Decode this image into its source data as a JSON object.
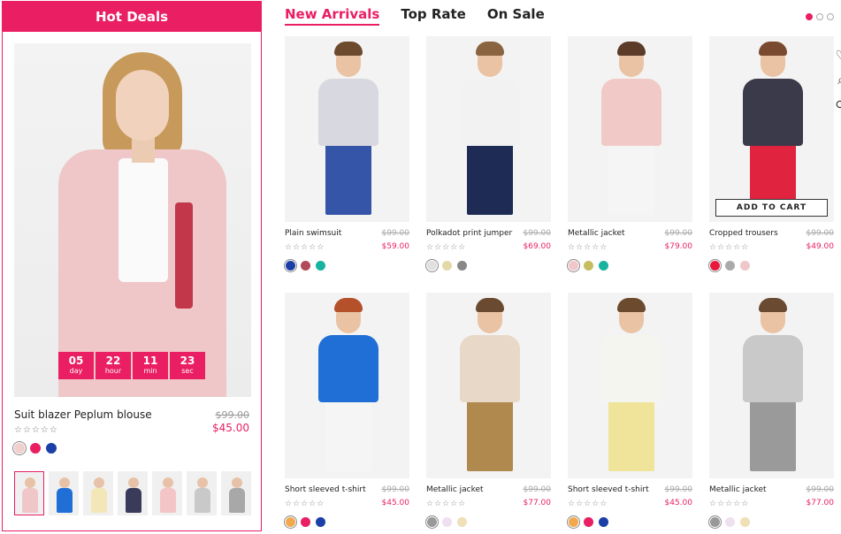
{
  "hot_deals": {
    "title": "Hot Deals",
    "product": {
      "name": "Suit blazer Peplum blouse",
      "old_price": "$99.00",
      "price": "$45.00",
      "stars": "☆☆☆☆☆",
      "swatches": [
        "#f0d0cc",
        "#e91e63",
        "#1b3fa6"
      ]
    },
    "countdown": [
      {
        "num": "05",
        "unit": "day"
      },
      {
        "num": "22",
        "unit": "hour"
      },
      {
        "num": "11",
        "unit": "min"
      },
      {
        "num": "23",
        "unit": "sec"
      }
    ],
    "thumbnails": [
      {
        "color": "#f0c7c8"
      },
      {
        "color": "#1f6fd6"
      },
      {
        "color": "#f3e7b8"
      },
      {
        "color": "#3a3a5a"
      },
      {
        "color": "#f4c5c7"
      },
      {
        "color": "#c9c9c9"
      },
      {
        "color": "#a8a8a8"
      }
    ]
  },
  "tabs": [
    {
      "label": "New Arrivals",
      "active": true
    },
    {
      "label": "Top Rate",
      "active": false
    },
    {
      "label": "On Sale",
      "active": false
    }
  ],
  "carousel_dots": 3,
  "add_to_cart": "ADD TO CART",
  "products": [
    {
      "name": "Plain swimsuit",
      "old_price": "$99.00",
      "price": "$59.00",
      "stars": "☆☆☆☆☆",
      "swatches": [
        "#1b3fa6",
        "#b04a5a",
        "#18b3a0"
      ],
      "top": "#d8d8e0",
      "bottom": "#3556a8",
      "hair": "#6b4a2e"
    },
    {
      "name": "Polkadot print jumper",
      "old_price": "$99.00",
      "price": "$69.00",
      "stars": "☆☆☆☆☆",
      "swatches": [
        "#e0e0e0",
        "#e4d9a6",
        "#888888"
      ],
      "top": "#f2f2f2",
      "bottom": "#1e2b55",
      "hair": "#8a6440"
    },
    {
      "name": "Metallic jacket",
      "old_price": "$99.00",
      "price": "$79.00",
      "stars": "☆☆☆☆☆",
      "swatches": [
        "#f0c7c8",
        "#c8bd5e",
        "#18b3a0"
      ],
      "top": "#f1c9c6",
      "bottom": "#f5f5f5",
      "hair": "#5a3c28"
    },
    {
      "name": "Cropped trousers",
      "old_price": "$99.00",
      "price": "$49.00",
      "stars": "☆☆☆☆☆",
      "swatches": [
        "#e8193c",
        "#aaaaaa",
        "#f0c7c8"
      ],
      "top": "#3a3a4a",
      "bottom": "#e0233e",
      "hair": "#7a4a30"
    },
    {
      "name": "Short sleeved t-shirt",
      "old_price": "$99.00",
      "price": "$45.00",
      "stars": "☆☆☆☆☆",
      "swatches": [
        "#f2a94d",
        "#e91e63",
        "#1b3fa6"
      ],
      "top": "#1f6fd6",
      "bottom": "#f5f5f5",
      "hair": "#b4502a"
    },
    {
      "name": "Metallic jacket",
      "old_price": "$99.00",
      "price": "$77.00",
      "stars": "☆☆☆☆☆",
      "swatches": [
        "#999999",
        "#efe0ef",
        "#efe0b8"
      ],
      "top": "#e8d8c8",
      "bottom": "#b0894f",
      "hair": "#6a4a30"
    },
    {
      "name": "Short sleeved t-shirt",
      "old_price": "$99.00",
      "price": "$45.00",
      "stars": "☆☆☆☆☆",
      "swatches": [
        "#f2a94d",
        "#e91e63",
        "#1b3fa6"
      ],
      "top": "#f5f5f0",
      "bottom": "#f0e49a",
      "hair": "#6b4a2e"
    },
    {
      "name": "Metallic jacket",
      "old_price": "$99.00",
      "price": "$77.00",
      "stars": "☆☆☆☆☆",
      "swatches": [
        "#999999",
        "#efe0ef",
        "#efe0b8"
      ],
      "top": "#c9c9c9",
      "bottom": "#9a9a9a",
      "hair": "#6a4a30"
    }
  ]
}
